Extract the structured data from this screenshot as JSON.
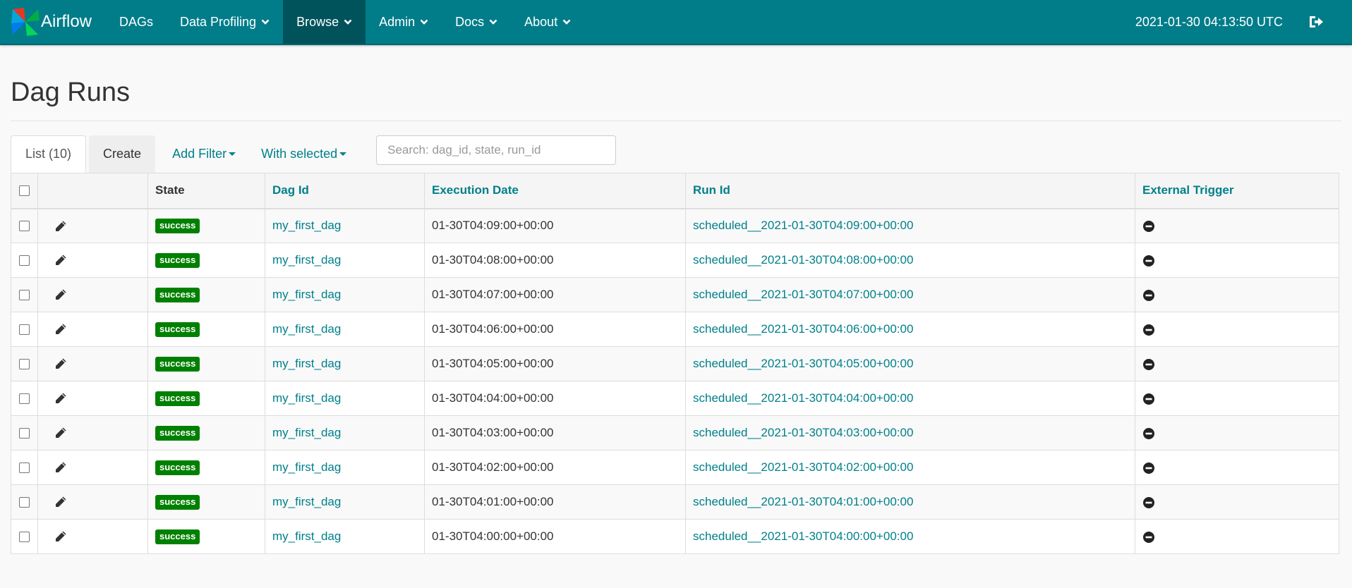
{
  "nav": {
    "brand": "Airflow",
    "items": [
      {
        "label": "DAGs",
        "dropdown": false,
        "active": false
      },
      {
        "label": "Data Profiling",
        "dropdown": true,
        "active": false
      },
      {
        "label": "Browse",
        "dropdown": true,
        "active": true
      },
      {
        "label": "Admin",
        "dropdown": true,
        "active": false
      },
      {
        "label": "Docs",
        "dropdown": true,
        "active": false
      },
      {
        "label": "About",
        "dropdown": true,
        "active": false
      }
    ],
    "clock": "2021-01-30 04:13:50 UTC",
    "logout_icon": "sign-out-icon"
  },
  "page": {
    "title": "Dag Runs"
  },
  "toolbar": {
    "list_tab": "List (10)",
    "create_tab": "Create",
    "add_filter": "Add Filter",
    "with_selected": "With selected",
    "search_placeholder": "Search: dag_id, state, run_id"
  },
  "table": {
    "headers": {
      "state": "State",
      "dag_id": "Dag Id",
      "execution_date": "Execution Date",
      "run_id": "Run Id",
      "external_trigger": "External Trigger"
    },
    "rows": [
      {
        "state": "success",
        "dag_id": "my_first_dag",
        "execution_date": "01-30T04:09:00+00:00",
        "run_id": "scheduled__2021-01-30T04:09:00+00:00"
      },
      {
        "state": "success",
        "dag_id": "my_first_dag",
        "execution_date": "01-30T04:08:00+00:00",
        "run_id": "scheduled__2021-01-30T04:08:00+00:00"
      },
      {
        "state": "success",
        "dag_id": "my_first_dag",
        "execution_date": "01-30T04:07:00+00:00",
        "run_id": "scheduled__2021-01-30T04:07:00+00:00"
      },
      {
        "state": "success",
        "dag_id": "my_first_dag",
        "execution_date": "01-30T04:06:00+00:00",
        "run_id": "scheduled__2021-01-30T04:06:00+00:00"
      },
      {
        "state": "success",
        "dag_id": "my_first_dag",
        "execution_date": "01-30T04:05:00+00:00",
        "run_id": "scheduled__2021-01-30T04:05:00+00:00"
      },
      {
        "state": "success",
        "dag_id": "my_first_dag",
        "execution_date": "01-30T04:04:00+00:00",
        "run_id": "scheduled__2021-01-30T04:04:00+00:00"
      },
      {
        "state": "success",
        "dag_id": "my_first_dag",
        "execution_date": "01-30T04:03:00+00:00",
        "run_id": "scheduled__2021-01-30T04:03:00+00:00"
      },
      {
        "state": "success",
        "dag_id": "my_first_dag",
        "execution_date": "01-30T04:02:00+00:00",
        "run_id": "scheduled__2021-01-30T04:02:00+00:00"
      },
      {
        "state": "success",
        "dag_id": "my_first_dag",
        "execution_date": "01-30T04:01:00+00:00",
        "run_id": "scheduled__2021-01-30T04:01:00+00:00"
      },
      {
        "state": "success",
        "dag_id": "my_first_dag",
        "execution_date": "01-30T04:00:00+00:00",
        "run_id": "scheduled__2021-01-30T04:00:00+00:00"
      }
    ]
  },
  "colors": {
    "navbar": "#017d8a",
    "navbar_active": "#00535b",
    "link": "#00808a",
    "success": "#008000"
  }
}
